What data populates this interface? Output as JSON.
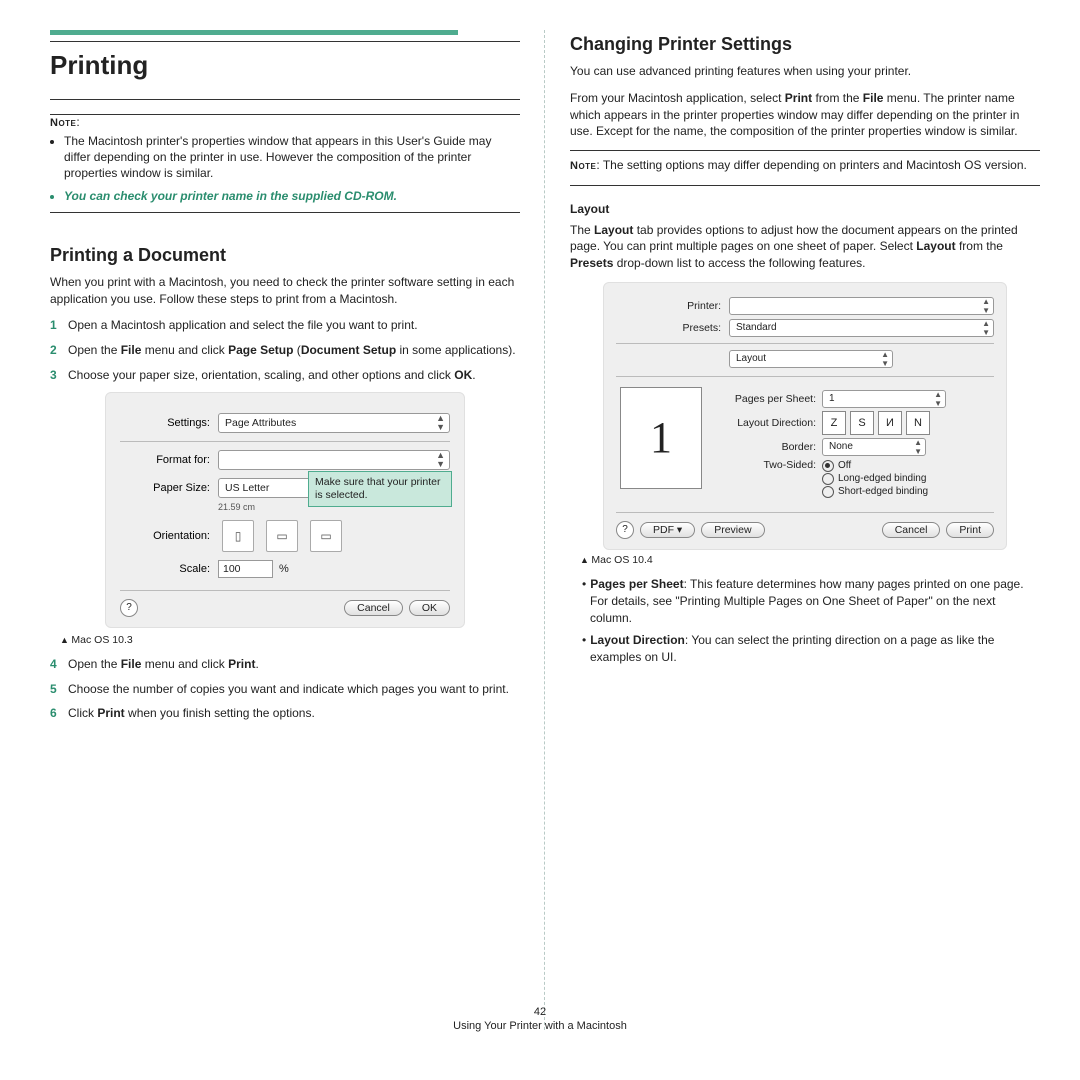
{
  "left": {
    "h1": "Printing",
    "note_label": "Note",
    "note_li1": "The Macintosh printer's properties window that appears in this User's Guide may differ depending on the printer in use. However the composition of the printer properties window is similar.",
    "note_li2": "You can check your printer name in the supplied CD-ROM.",
    "h2": "Printing a Document",
    "intro": "When you print with a Macintosh, you need to check the printer software setting in each application you use. Follow these steps to print from a Macintosh.",
    "s1": "Open a Macintosh application and select the file you want to print.",
    "s2a": "Open the ",
    "s2b": "File",
    "s2c": " menu and click ",
    "s2d": "Page Setup",
    "s2e": " (",
    "s2f": "Document Setup",
    "s2g": " in some applications).",
    "s3a": "Choose your paper size, orientation, scaling, and other options and click ",
    "s3b": "OK",
    "s3c": ".",
    "dlg": {
      "settings_l": "Settings:",
      "settings_v": "Page Attributes",
      "format_l": "Format for:",
      "paper_l": "Paper Size:",
      "paper_v": "US Letter",
      "paper_dim": "21.59 cm",
      "orient_l": "Orientation:",
      "scale_l": "Scale:",
      "scale_v": "100",
      "pct": "%",
      "callout": "Make sure that your printer is selected.",
      "cancel": "Cancel",
      "ok": "OK"
    },
    "caption1": "Mac OS 10.3",
    "s4a": "Open the ",
    "s4b": "File",
    "s4c": " menu and click ",
    "s4d": "Print",
    "s4e": ".",
    "s5": "Choose the number of copies you want and indicate which pages you want to print.",
    "s6a": "Click ",
    "s6b": "Print",
    "s6c": " when you finish setting the options."
  },
  "right": {
    "h2": "Changing Printer Settings",
    "p1": "You can use advanced printing features when using your printer.",
    "p2a": "From your Macintosh application, select ",
    "p2b": "Print",
    "p2c": " from the ",
    "p2d": "File",
    "p2e": " menu. The printer name which appears in the printer properties window may differ depending on the printer in use. Except for the name, the composition of the printer properties window is similar.",
    "note_l": "Note",
    "note_p": ": The setting options may differ depending on printers and Macintosh OS version.",
    "h3": "Layout",
    "layout_p1": "The ",
    "layout_p2": "Layout",
    "layout_p3": " tab provides options to adjust how the document appears on the printed page. You can print multiple pages on one sheet of paper. Select ",
    "layout_p4": "Layout",
    "layout_p5": " from the ",
    "layout_p6": "Presets",
    "layout_p7": " drop-down list to access the following features.",
    "dlg": {
      "printer_l": "Printer:",
      "presets_l": "Presets:",
      "presets_v": "Standard",
      "section_v": "Layout",
      "pps_l": "Pages per Sheet:",
      "pps_v": "1",
      "ld_l": "Layout Direction:",
      "border_l": "Border:",
      "border_v": "None",
      "ts_l": "Two-Sided:",
      "ts_off": "Off",
      "ts_long": "Long-edged binding",
      "ts_short": "Short-edged binding",
      "pdf": "PDF ▾",
      "preview": "Preview",
      "cancel": "Cancel",
      "print": "Print",
      "big1": "1"
    },
    "caption2": "Mac OS 10.4",
    "b1a": "Pages per Sheet",
    "b1b": ": This feature determines how many pages printed on one page. For details, see \"Printing Multiple Pages on One Sheet of Paper\" on the next column.",
    "b2a": "Layout Direction",
    "b2b": ": You can select the printing direction on a page as like the examples on UI."
  },
  "footer": {
    "num": "42",
    "text": "Using Your Printer with a Macintosh"
  }
}
